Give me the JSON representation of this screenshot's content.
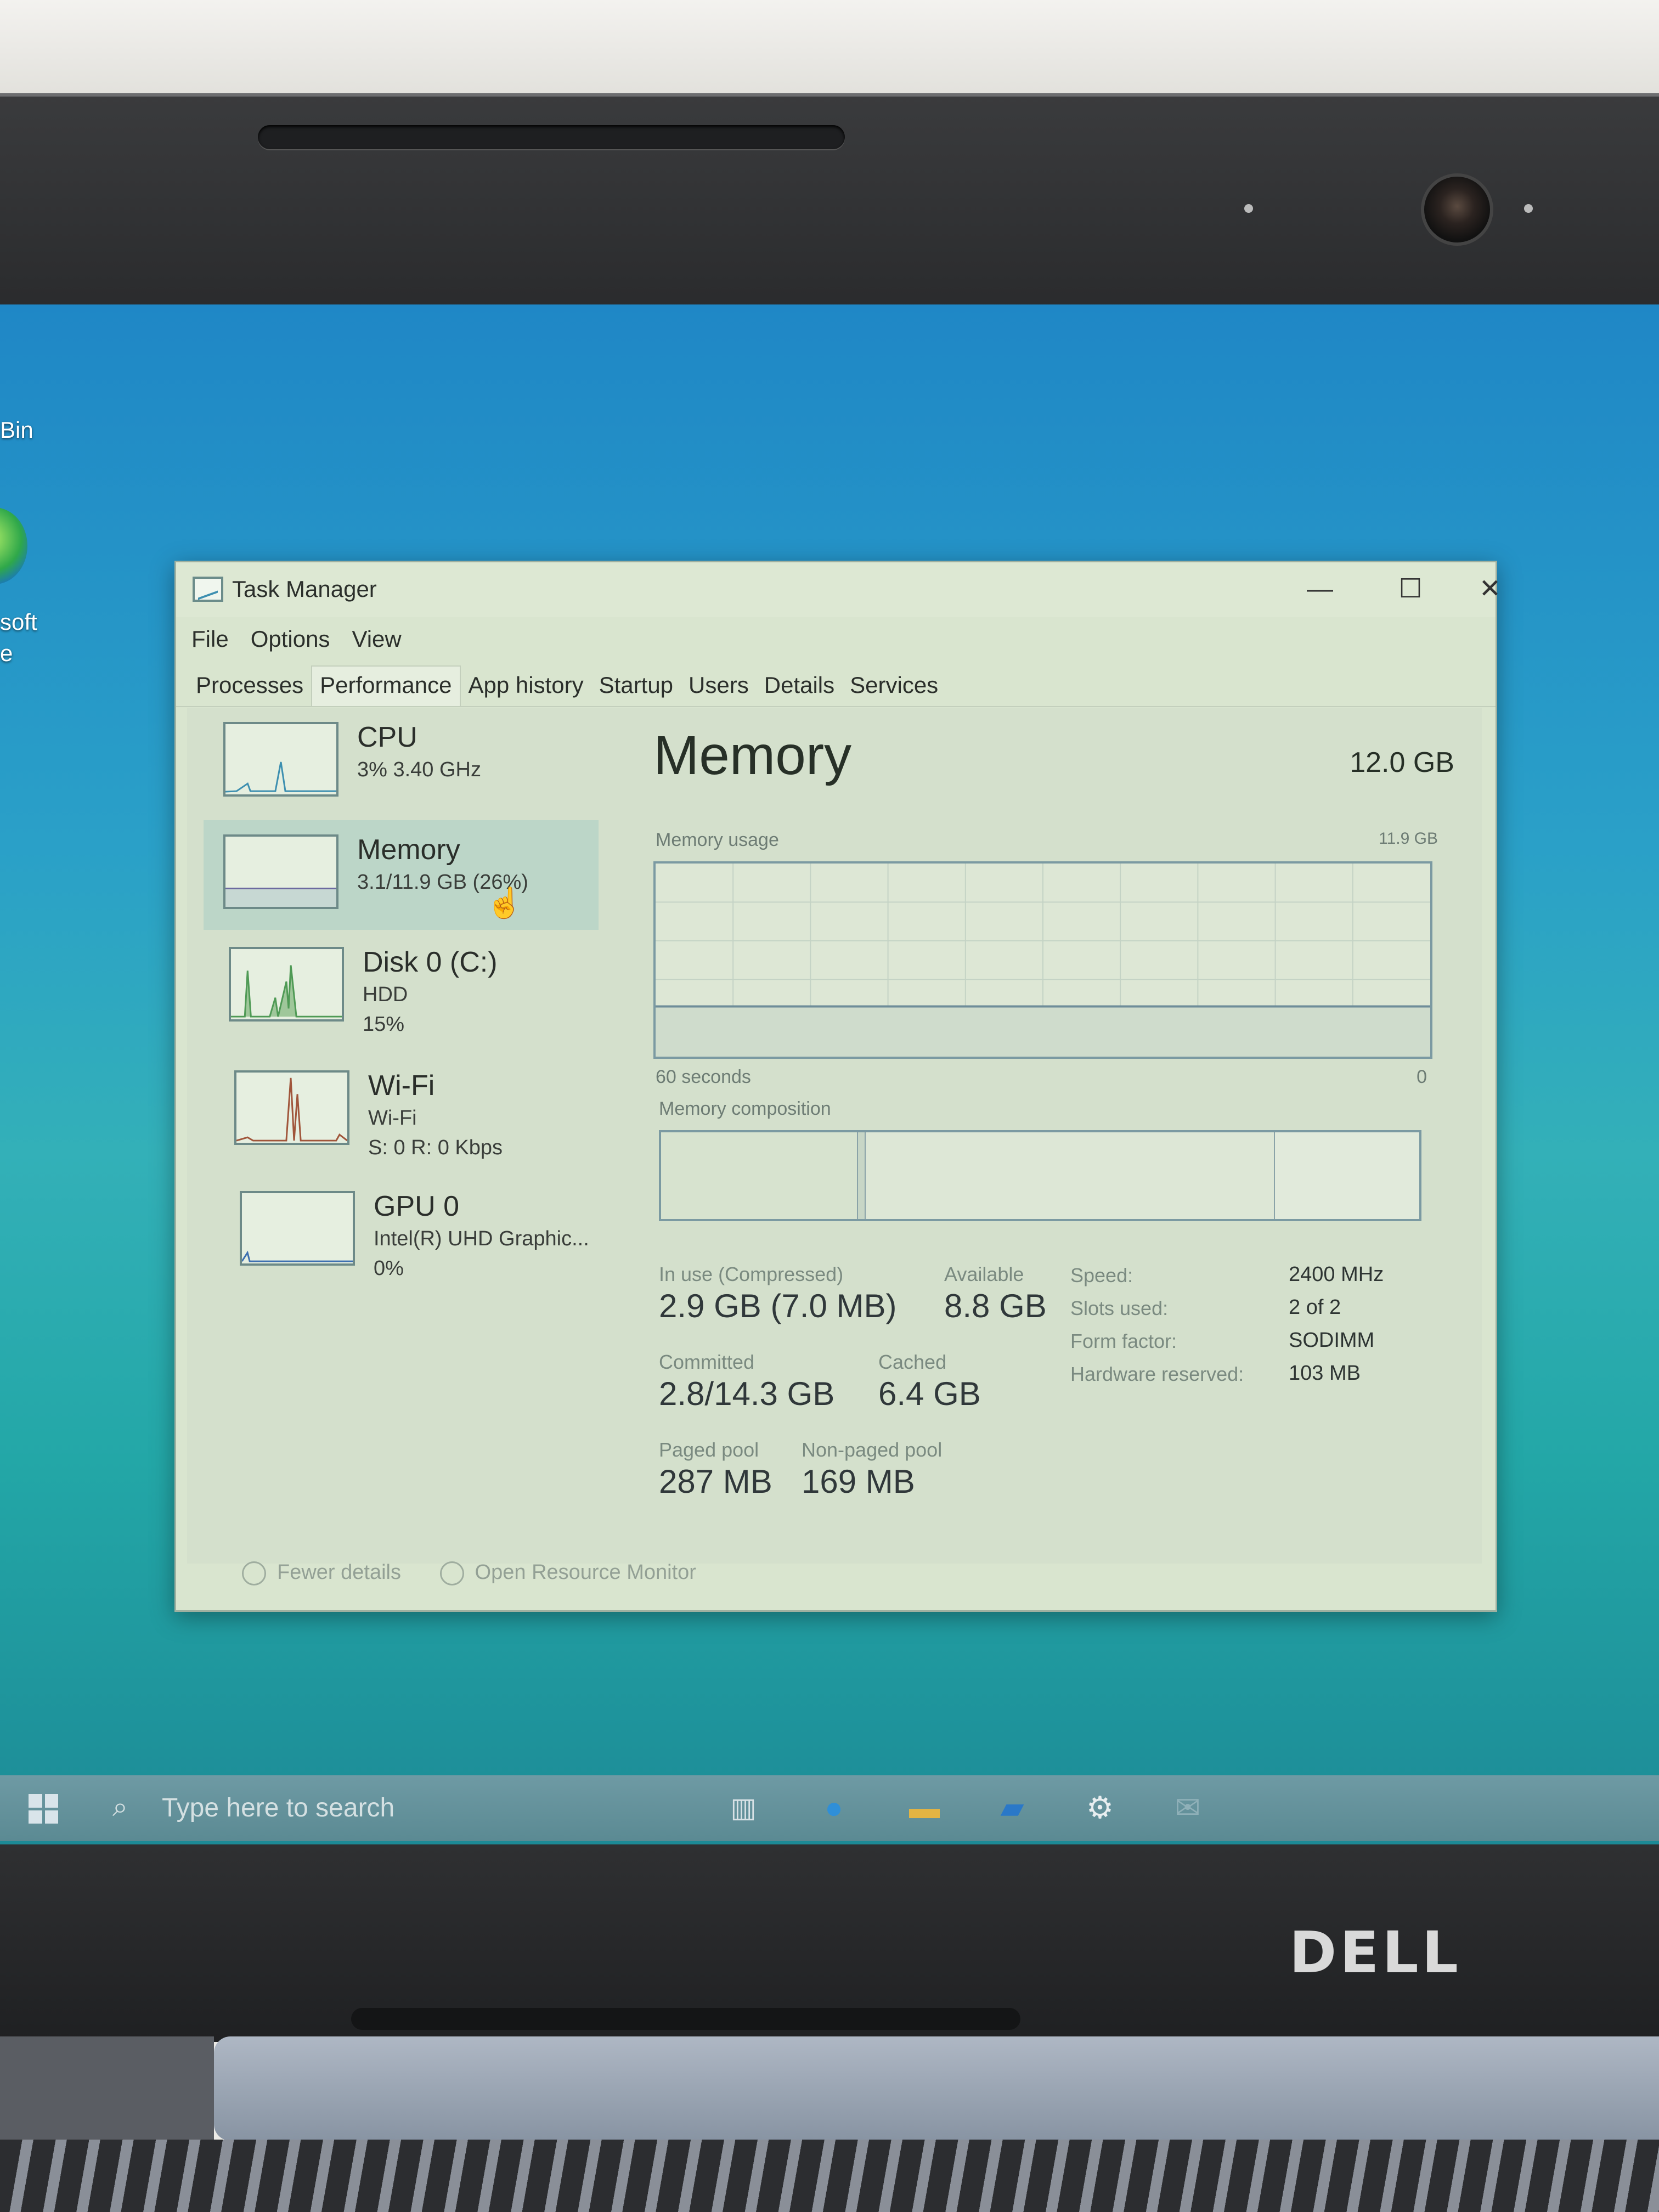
{
  "desktop": {
    "labels": [
      "Bin",
      "soft",
      "e"
    ]
  },
  "window": {
    "title": "Task Manager",
    "controls": {
      "minimize": "—",
      "maximize": "☐",
      "close": "✕"
    }
  },
  "menu": [
    "File",
    "Options",
    "View"
  ],
  "tabs": [
    "Processes",
    "Performance",
    "App history",
    "Startup",
    "Users",
    "Details",
    "Services"
  ],
  "active_tab": "Performance",
  "sidebar": {
    "items": [
      {
        "title": "CPU",
        "lines": [
          "3% 3.40 GHz"
        ]
      },
      {
        "title": "Memory",
        "lines": [
          "3.1/11.9 GB (26%)"
        ]
      },
      {
        "title": "Disk 0 (C:)",
        "lines": [
          "HDD",
          "15%"
        ]
      },
      {
        "title": "Wi-Fi",
        "lines": [
          "Wi-Fi",
          "S: 0 R: 0 Kbps"
        ]
      },
      {
        "title": "GPU 0",
        "lines": [
          "Intel(R) UHD Graphic...",
          "0%"
        ]
      }
    ]
  },
  "memory": {
    "title": "Memory",
    "total": "12.0 GB",
    "usage_label": "Memory usage",
    "usage_max": "11.9 GB",
    "axis_left": "60 seconds",
    "axis_right": "0",
    "usage_fraction": 0.26,
    "composition_label": "Memory composition",
    "composition": {
      "in_use": 0.26,
      "modified": 0.01,
      "standby": 0.54,
      "free": 0.19
    },
    "stats": {
      "in_use_label": "In use (Compressed)",
      "in_use_value": "2.9 GB (7.0 MB)",
      "available_label": "Available",
      "available_value": "8.8 GB",
      "committed_label": "Committed",
      "committed_value": "2.8/14.3 GB",
      "cached_label": "Cached",
      "cached_value": "6.4 GB",
      "paged_label": "Paged pool",
      "paged_value": "287 MB",
      "nonpaged_label": "Non-paged pool",
      "nonpaged_value": "169 MB"
    },
    "specs": [
      {
        "label": "Speed:",
        "value": "2400 MHz"
      },
      {
        "label": "Slots used:",
        "value": "2 of 2"
      },
      {
        "label": "Form factor:",
        "value": "SODIMM"
      },
      {
        "label": "Hardware reserved:",
        "value": "103 MB"
      }
    ]
  },
  "footer": {
    "fewer_details": "Fewer details",
    "open_resource_monitor": "Open Resource Monitor"
  },
  "taskbar": {
    "search_placeholder": "Type here to search",
    "icons": [
      "task-view-icon",
      "edge-icon",
      "file-explorer-icon",
      "store-icon",
      "settings-icon",
      "mail-icon"
    ]
  },
  "laptop": {
    "brand": "DELL"
  },
  "colors": {
    "accent": "#3d8fb0",
    "window_bg": "#d9e5cf",
    "selected": "#bcd6c8"
  }
}
